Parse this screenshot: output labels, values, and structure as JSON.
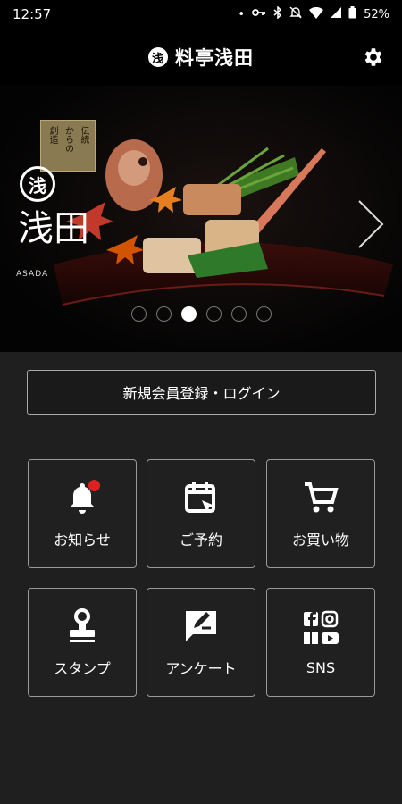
{
  "status": {
    "time": "12:57",
    "battery": "52%"
  },
  "header": {
    "title": "料亭浅田",
    "mark": "浅"
  },
  "hero": {
    "tag_columns": [
      "伝統",
      "からの",
      "創造"
    ],
    "logo_mark": "浅",
    "logo_script": "浅田",
    "logo_roman": "ASADA",
    "slide_count": 6,
    "active_slide": 3
  },
  "login_label": "新規会員登録・ログイン",
  "menu": {
    "news": "お知らせ",
    "reserve": "ご予約",
    "shop": "お買い物",
    "stamp": "スタンプ",
    "survey": "アンケート",
    "sns": "SNS"
  },
  "colors": {
    "accent_badge": "#e02020",
    "background": "#1f1f1f"
  }
}
